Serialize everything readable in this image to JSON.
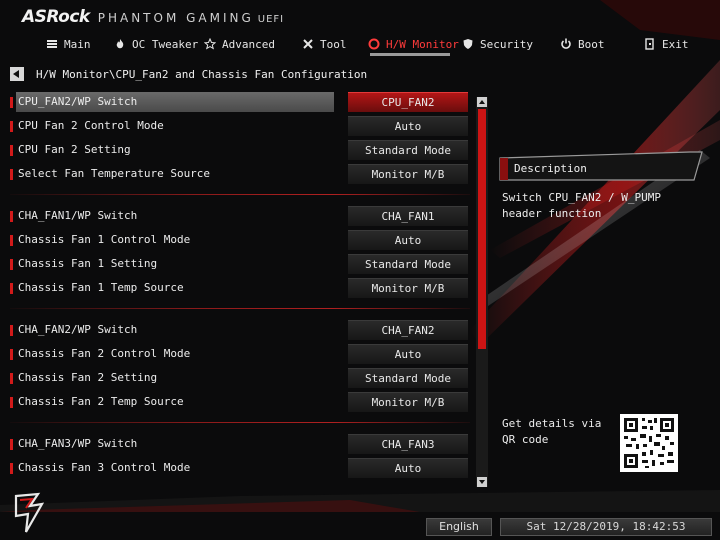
{
  "brand": {
    "logo": "ASRock",
    "subtitle": "PHANTOM GAMING",
    "uefi": "UEFI"
  },
  "nav": [
    {
      "label": "Main",
      "icon": "list-icon"
    },
    {
      "label": "OC Tweaker",
      "icon": "flame-icon"
    },
    {
      "label": "Advanced",
      "icon": "star-icon"
    },
    {
      "label": "Tool",
      "icon": "tools-icon"
    },
    {
      "label": "H/W Monitor",
      "icon": "monitor-icon",
      "active": true
    },
    {
      "label": "Security",
      "icon": "shield-icon"
    },
    {
      "label": "Boot",
      "icon": "power-icon"
    },
    {
      "label": "Exit",
      "icon": "exit-icon"
    }
  ],
  "breadcrumb": "H/W Monitor\\CPU_Fan2 and Chassis Fan Configuration",
  "settings": [
    {
      "label": "CPU_FAN2/WP Switch",
      "value": "CPU_FAN2",
      "selected": true
    },
    {
      "label": "CPU Fan 2 Control Mode",
      "value": "Auto"
    },
    {
      "label": "CPU Fan 2 Setting",
      "value": "Standard Mode"
    },
    {
      "label": "Select Fan Temperature Source",
      "value": "Monitor M/B"
    },
    {
      "label": "CHA_FAN1/WP Switch",
      "value": "CHA_FAN1"
    },
    {
      "label": "Chassis Fan 1 Control Mode",
      "value": "Auto"
    },
    {
      "label": "Chassis Fan 1 Setting",
      "value": "Standard Mode"
    },
    {
      "label": "Chassis Fan 1 Temp Source",
      "value": "Monitor M/B"
    },
    {
      "label": "CHA_FAN2/WP Switch",
      "value": "CHA_FAN2"
    },
    {
      "label": "Chassis Fan 2 Control Mode",
      "value": "Auto"
    },
    {
      "label": "Chassis Fan 2 Setting",
      "value": "Standard Mode"
    },
    {
      "label": "Chassis Fan 2 Temp Source",
      "value": "Monitor M/B"
    },
    {
      "label": "CHA_FAN3/WP Switch",
      "value": "CHA_FAN3"
    },
    {
      "label": "Chassis Fan 3 Control Mode",
      "value": "Auto"
    }
  ],
  "description": {
    "title": "Description",
    "text": "Switch CPU_FAN2 / W_PUMP header function"
  },
  "qr": {
    "text": "Get details via QR code"
  },
  "footer": {
    "language": "English",
    "datetime": "Sat 12/28/2019, 18:42:53"
  },
  "colors": {
    "accent": "#cc1414",
    "active_tab": "#ff3b3b",
    "background": "#0b0b0c"
  }
}
